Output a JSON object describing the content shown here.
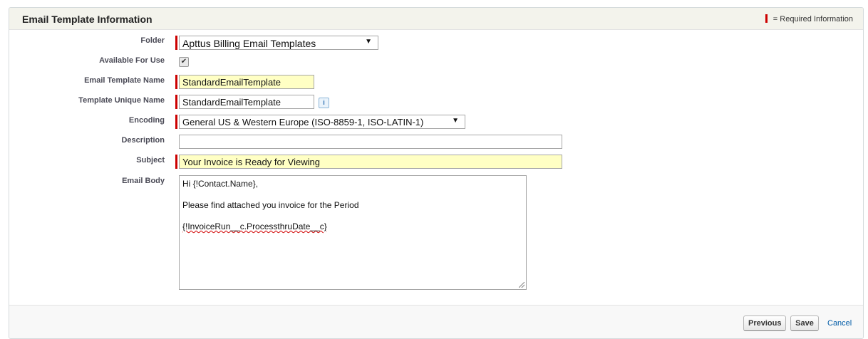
{
  "section": {
    "title": "Email Template Information",
    "required_legend": "= Required Information"
  },
  "fields": {
    "folder": {
      "label": "Folder",
      "value": "Apttus Billing Email Templates"
    },
    "available_for_use": {
      "label": "Available For Use",
      "checked": true
    },
    "email_template_name": {
      "label": "Email Template Name",
      "value": "StandardEmailTemplate"
    },
    "template_unique_name": {
      "label": "Template Unique Name",
      "value": "StandardEmailTemplate"
    },
    "encoding": {
      "label": "Encoding",
      "value": "General US & Western Europe (ISO-8859-1, ISO-LATIN-1)"
    },
    "description": {
      "label": "Description",
      "value": ""
    },
    "subject": {
      "label": "Subject",
      "value": "Your Invoice is Ready for Viewing"
    },
    "email_body": {
      "label": "Email Body",
      "lines": [
        "Hi {!Contact.Name},",
        "Please find attached you invoice for the Period",
        "{!InvoiceRun__c.ProcessthruDate__c}"
      ]
    }
  },
  "buttons": {
    "previous": "Previous",
    "save": "Save",
    "cancel": "Cancel"
  },
  "colors": {
    "required": "#cc0000",
    "highlight": "#ffffc4",
    "link": "#015ba7"
  }
}
